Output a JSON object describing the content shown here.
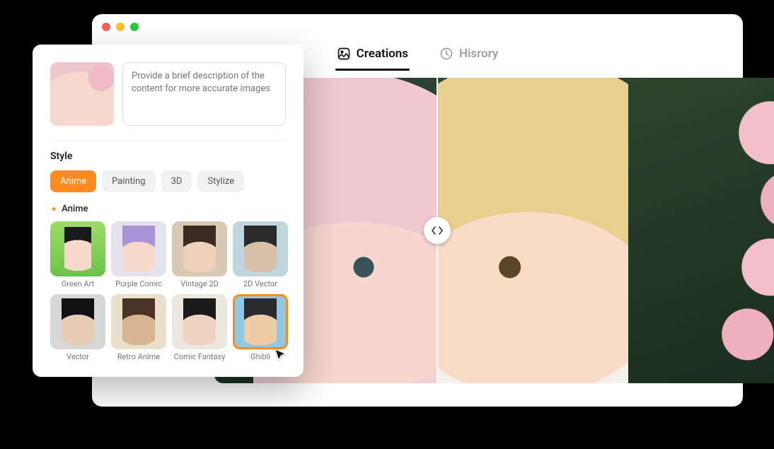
{
  "tabs": {
    "creations": "Creations",
    "history": "Hisrory"
  },
  "panel": {
    "prompt_placeholder": "Provide a brief description of the content for more accurate images",
    "style_title": "Style",
    "chips": {
      "anime": "Anime",
      "painting": "Painting",
      "threeD": "3D",
      "stylize": "Stylize"
    },
    "subhead": "Anime",
    "styles": [
      {
        "label": "Green Art"
      },
      {
        "label": "Purple Comic"
      },
      {
        "label": "Vintage 2D"
      },
      {
        "label": "2D Vector"
      },
      {
        "label": "Vector"
      },
      {
        "label": "Retro Anime"
      },
      {
        "label": "Comic Fantasy"
      },
      {
        "label": "Ghibli"
      }
    ]
  }
}
